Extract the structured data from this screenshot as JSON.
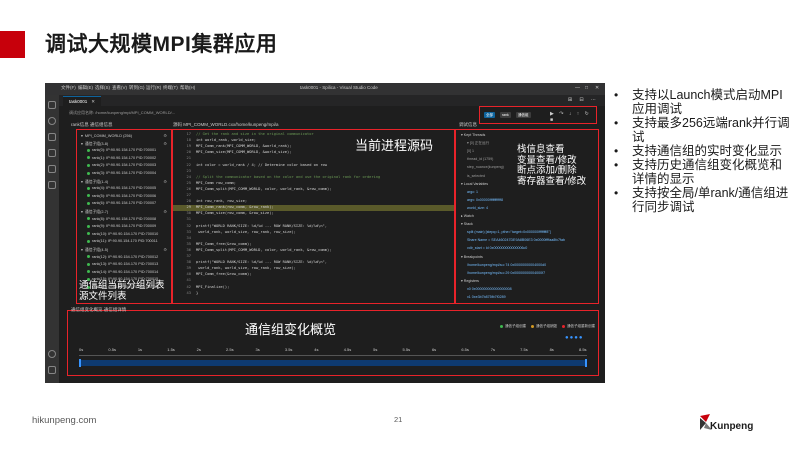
{
  "slide": {
    "title": "调试大规模MPI集群应用",
    "footer_url": "hikunpeng.com",
    "page_number": "21",
    "brand": "Kunpeng",
    "accent_color": "#c7000b"
  },
  "bullets": [
    "支持以Launch模式启动MPI应用调试",
    "支持最多256远端rank并行调试",
    "支持通信组的实时变化显示",
    "支持历史通信组变化概览和详情的显示",
    "支持按全局/单rank/通信组进行同步调试"
  ],
  "ide": {
    "menu": [
      "文件(F)",
      "编辑(E)",
      "选择(S)",
      "查看(V)",
      "转到(G)",
      "运行(R)",
      "终端(T)",
      "帮助(H)"
    ],
    "window_title": "task0001 - Spilica - Visual Studio Code",
    "tab_label": "task0001",
    "config_text": "调试应用名称: /home/kunpeng/mpi/MPI_COMM_WORLD/...",
    "toolbar_buttons": [
      "全部",
      "rank",
      "通信组"
    ],
    "panels": {
      "rank": "rank信息  通信组信息",
      "source": "源码  MPI_COMM_WORLD.cxx/home/kunpeng/mpi/a",
      "debug": "调试信息",
      "comm": "通信组变化概览  通信组详情"
    },
    "rank_rows": [
      {
        "kind": "group",
        "text": "MPI_COMM_WORLD (256)"
      },
      {
        "kind": "group",
        "text": "通信子组(3-8)"
      },
      {
        "kind": "item",
        "text": "rank(0): IP:90.90.154.170 PID:700001"
      },
      {
        "kind": "item",
        "text": "rank(1): IP:90.90.154.170 PID:700002"
      },
      {
        "kind": "item",
        "text": "rank(2): IP:90.90.154.170 PID:700003"
      },
      {
        "kind": "item",
        "text": "rank(3): IP:90.90.154.170 PID:700004"
      },
      {
        "kind": "group",
        "text": "通信子组(1-4)"
      },
      {
        "kind": "item",
        "text": "rank(4): IP:90.90.154.170 PID:700005"
      },
      {
        "kind": "item",
        "text": "rank(5): IP:90.90.154.170 PID:700006"
      },
      {
        "kind": "item",
        "text": "rank(6): IP:90.90.154.170 PID:700007"
      },
      {
        "kind": "group",
        "text": "通信子组(2-7)"
      },
      {
        "kind": "item",
        "text": "rank(8): IP:90.90.154.170 PID:700008"
      },
      {
        "kind": "item",
        "text": "rank(9): IP:90.90.154.170 PID:700009"
      },
      {
        "kind": "item",
        "text": "rank(10): IP:90.90.154.170 PID:700010"
      },
      {
        "kind": "item",
        "text": "rank(11): IP:90.90.154.170 PID:700011"
      },
      {
        "kind": "group",
        "text": "通信子组(4-5)"
      },
      {
        "kind": "item",
        "text": "rank(12): IP:90.90.154.170 PID:700012"
      },
      {
        "kind": "item",
        "text": "rank(13): IP:90.90.154.170 PID:700013"
      },
      {
        "kind": "item",
        "text": "rank(14): IP:90.90.154.170 PID:700014"
      },
      {
        "kind": "item",
        "text": "rank(15): IP:90.90.154.170 PID:700015"
      },
      {
        "kind": "item",
        "text": "rank(16): IP:90.90.154.170 PID:700016"
      }
    ],
    "code_lines": [
      {
        "n": "17",
        "text": "// Get the rank and size in the original communicator",
        "cls": "cmt"
      },
      {
        "n": "18",
        "text": "int world_rank, world_size;",
        "cls": ""
      },
      {
        "n": "19",
        "text": "MPI_Comm_rank(MPI_COMM_WORLD, &world_rank);",
        "cls": ""
      },
      {
        "n": "20",
        "text": "MPI_Comm_size(MPI_COMM_WORLD, &world_size);",
        "cls": ""
      },
      {
        "n": "21",
        "text": "",
        "cls": ""
      },
      {
        "n": "22",
        "text": "int color = world_rank / 4; // Determine color based on row",
        "cls": ""
      },
      {
        "n": "23",
        "text": "",
        "cls": ""
      },
      {
        "n": "24",
        "text": "// Split the communicator based on the color and use the original rank for ordering",
        "cls": "cmt"
      },
      {
        "n": "25",
        "text": "MPI_Comm row_comm;",
        "cls": ""
      },
      {
        "n": "26",
        "text": "MPI_Comm_split(MPI_COMM_WORLD, color, world_rank, &row_comm);",
        "cls": ""
      },
      {
        "n": "27",
        "text": "",
        "cls": ""
      },
      {
        "n": "28",
        "text": "int row_rank, row_size;",
        "cls": ""
      },
      {
        "n": "29",
        "text": "MPI_Comm_rank(row_comm, &row_rank);",
        "cls": "hl"
      },
      {
        "n": "30",
        "text": "MPI_Comm_size(row_comm, &row_size);",
        "cls": ""
      },
      {
        "n": "31",
        "text": "",
        "cls": ""
      },
      {
        "n": "32",
        "text": "printf(\"WORLD RANK/SIZE: %d/%d  --- ROW RANK/SIZE: %d/%d\\n\",",
        "cls": ""
      },
      {
        "n": "33",
        "text": "  world_rank, world_size, row_rank, row_size);",
        "cls": ""
      },
      {
        "n": "34",
        "text": "",
        "cls": ""
      },
      {
        "n": "35",
        "text": "MPI_Comm_free(&row_comm);",
        "cls": ""
      },
      {
        "n": "36",
        "text": "MPI_Comm_split(MPI_COMM_WORLD, color, world_rank, &row_comm);",
        "cls": ""
      },
      {
        "n": "37",
        "text": "",
        "cls": ""
      },
      {
        "n": "38",
        "text": "printf(\"WORLD RANK/SIZE: %d/%d  --- ROW RANK/SIZE: %d/%d\\n\",",
        "cls": ""
      },
      {
        "n": "39",
        "text": "  world_rank, world_size, row_rank, row_size);",
        "cls": ""
      },
      {
        "n": "40",
        "text": "MPI_Comm_free(&row_comm);",
        "cls": ""
      },
      {
        "n": "41",
        "text": "",
        "cls": ""
      },
      {
        "n": "42",
        "text": "MPI_Finalize();",
        "cls": ""
      },
      {
        "n": "43",
        "text": "}",
        "cls": ""
      }
    ],
    "debug_rows": [
      {
        "cls": "",
        "text": "▾ Kept Threads"
      },
      {
        "cls": "sub",
        "text": "▾ [0] 正在运行"
      },
      {
        "cls": "sub",
        "text": "   [0] 1"
      },
      {
        "cls": "sub",
        "text": "   thread_id (1759)"
      },
      {
        "cls": "sub",
        "text": "   step_nuance(kunpeng)"
      },
      {
        "cls": "sub",
        "text": "   is_selected"
      },
      {
        "cls": "",
        "text": "▾ Local Variables"
      },
      {
        "cls": "val",
        "text": "argc: 1"
      },
      {
        "cls": "val",
        "text": "argv: 0x00000ffffffffffff8"
      },
      {
        "cls": "val",
        "text": "world_size: 4"
      },
      {
        "cls": "",
        "text": "▸ Watch"
      },
      {
        "cls": "",
        "text": "▾ Stack"
      },
      {
        "cls": "val",
        "text": "split (main) [stepq=1, pthe=\"target=0x000000ffffffff8\"]"
      },
      {
        "cls": "val",
        "text": "Share Name = SEA460247DE9A8B06E3 0x0000ffffaa8fc7fab"
      },
      {
        "cls": "val",
        "text": "vdlr_start = ld 0x000000000000006c0"
      },
      {
        "cls": "",
        "text": "▾ Breakpoints"
      },
      {
        "cls": "val",
        "text": "/home/kunpeng/mpi/a.c:74 0x00000000004000d0"
      },
      {
        "cls": "val",
        "text": "/home/kunpeng/mpi/a.c:29 0x00000000004000f7"
      },
      {
        "cls": "",
        "text": "▾ Registers"
      },
      {
        "cls": "val",
        "text": "x0 0x000000000000000008"
      },
      {
        "cls": "val",
        "text": "x1 0xe3b7b875fb7f0289"
      }
    ],
    "legend": [
      {
        "label": "通信子组创建",
        "color": "#3fb950"
      },
      {
        "label": "通信子组销毁",
        "color": "#d29922"
      },
      {
        "label": "通信子组重新创建",
        "color": "#e8232a"
      }
    ],
    "timeline_ticks": [
      "0s",
      "0.5s",
      "1s",
      "1.5s",
      "2s",
      "2.5s",
      "3s",
      "3.5s",
      "4s",
      "4.5s",
      "5s",
      "5.5s",
      "6s",
      "6.5s",
      "7s",
      "7.5s",
      "8s",
      "8.5s"
    ]
  },
  "callouts": {
    "rank": [
      "通信组当前分组列表",
      "源文件列表"
    ],
    "source": "当前进程源码",
    "debug": [
      "栈信息查看",
      "变量查看/修改",
      "断点添加/删除",
      "寄存器查看/修改"
    ],
    "comm": "通信组变化概览"
  }
}
